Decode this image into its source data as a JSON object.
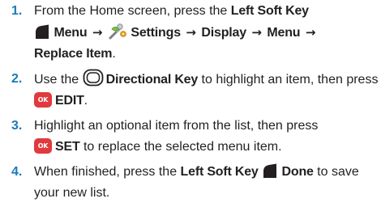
{
  "steps": [
    {
      "number": "1.",
      "intro": "From the Home screen, press the ",
      "left_soft_key": "Left Soft Key",
      "menu": "Menu",
      "arrow": "→",
      "settings": "Settings",
      "display": "Display",
      "menu2": "Menu",
      "replace_item": "Replace Item",
      "end": "."
    },
    {
      "number": "2.",
      "use_the": "Use the ",
      "directional_key": "Directional Key",
      "mid": " to highlight an item, then press ",
      "ok_icon_text": "OK",
      "edit": "EDIT",
      "end": "."
    },
    {
      "number": "3.",
      "intro": "Highlight an optional item from the list, then press ",
      "ok_icon_text": "OK",
      "set": "SET",
      "rest": " to replace the selected menu item."
    },
    {
      "number": "4.",
      "intro": "When finished, press the ",
      "left_soft_key": "Left Soft Key",
      "done": "Done",
      "rest": " to save your new list."
    }
  ],
  "colors": {
    "step_number": "#1a7ab8",
    "ok_key": "#e03a3e",
    "text": "#231f20"
  },
  "icons": [
    "left-soft-key-icon",
    "settings-icon",
    "directional-key-icon",
    "ok-key-icon"
  ]
}
